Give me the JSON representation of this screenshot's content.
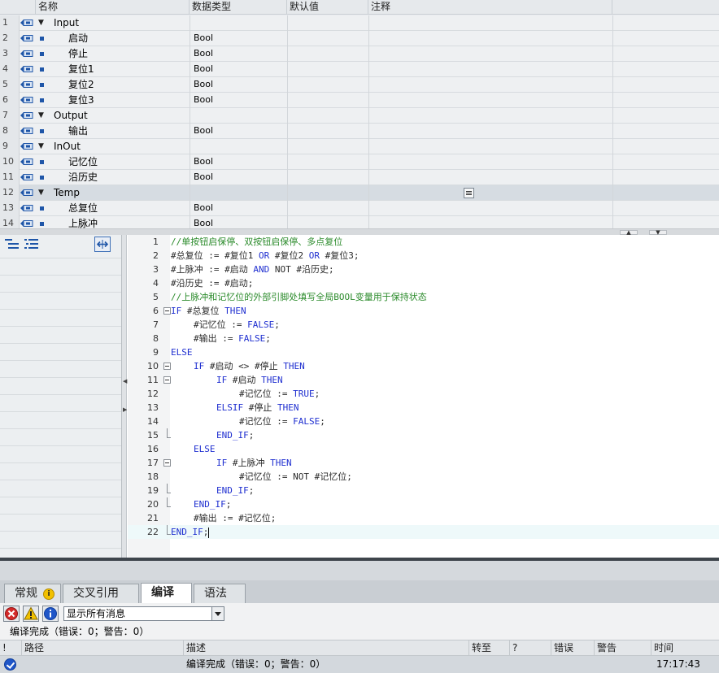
{
  "interface": {
    "columns": [
      "名称",
      "数据类型",
      "默认值",
      "注释"
    ],
    "rows": [
      {
        "num": "1",
        "name": "Input",
        "type": "",
        "section": true,
        "expanded": true
      },
      {
        "num": "2",
        "name": "启动",
        "type": "Bool",
        "section": false
      },
      {
        "num": "3",
        "name": "停止",
        "type": "Bool",
        "section": false
      },
      {
        "num": "4",
        "name": "复位1",
        "type": "Bool",
        "section": false
      },
      {
        "num": "5",
        "name": "复位2",
        "type": "Bool",
        "section": false
      },
      {
        "num": "6",
        "name": "复位3",
        "type": "Bool",
        "section": false
      },
      {
        "num": "7",
        "name": "Output",
        "type": "",
        "section": true,
        "expanded": true
      },
      {
        "num": "8",
        "name": "输出",
        "type": "Bool",
        "section": false
      },
      {
        "num": "9",
        "name": "InOut",
        "type": "",
        "section": true,
        "expanded": true
      },
      {
        "num": "10",
        "name": "记忆位",
        "type": "Bool",
        "section": false
      },
      {
        "num": "11",
        "name": "沿历史",
        "type": "Bool",
        "section": false
      },
      {
        "num": "12",
        "name": "Temp",
        "type": "",
        "section": true,
        "expanded": true,
        "selected": true
      },
      {
        "num": "13",
        "name": "总复位",
        "type": "Bool",
        "section": false
      },
      {
        "num": "14",
        "name": "上脉冲",
        "type": "Bool",
        "section": false
      }
    ]
  },
  "editor": {
    "lines": [
      {
        "num": "1",
        "indent": 0,
        "fold": "",
        "tokens": [
          {
            "t": "//单按钮启保停、双按钮启保停、多点复位",
            "c": "cm"
          }
        ]
      },
      {
        "num": "2",
        "indent": 0,
        "fold": "",
        "tokens": [
          {
            "t": "#总复位 := #复位1 ",
            "c": "vr"
          },
          {
            "t": "OR",
            "c": "kw"
          },
          {
            "t": " #复位2 ",
            "c": "vr"
          },
          {
            "t": "OR",
            "c": "kw"
          },
          {
            "t": " #复位3;",
            "c": "vr"
          }
        ]
      },
      {
        "num": "3",
        "indent": 0,
        "fold": "",
        "tokens": [
          {
            "t": "#上脉冲 := #启动 ",
            "c": "vr"
          },
          {
            "t": "AND",
            "c": "kw"
          },
          {
            "t": " NOT #沿历史;",
            "c": "vr"
          }
        ]
      },
      {
        "num": "4",
        "indent": 0,
        "fold": "",
        "tokens": [
          {
            "t": "#沿历史 := #启动;",
            "c": "vr"
          }
        ]
      },
      {
        "num": "5",
        "indent": 0,
        "fold": "",
        "tokens": [
          {
            "t": "//上脉冲和记忆位的外部引脚处填写全局BOOL变量用于保持状态",
            "c": "cm"
          }
        ]
      },
      {
        "num": "6",
        "indent": 0,
        "fold": "open",
        "tokens": [
          {
            "t": "IF",
            "c": "kw"
          },
          {
            "t": " #总复位 ",
            "c": "vr"
          },
          {
            "t": "THEN",
            "c": "kw"
          }
        ]
      },
      {
        "num": "7",
        "indent": 1,
        "fold": "",
        "tokens": [
          {
            "t": "#记忆位 := ",
            "c": "vr"
          },
          {
            "t": "FALSE",
            "c": "kw"
          },
          {
            "t": ";",
            "c": "vr"
          }
        ]
      },
      {
        "num": "8",
        "indent": 1,
        "fold": "",
        "tokens": [
          {
            "t": "#输出 := ",
            "c": "vr"
          },
          {
            "t": "FALSE",
            "c": "kw"
          },
          {
            "t": ";",
            "c": "vr"
          }
        ]
      },
      {
        "num": "9",
        "indent": 0,
        "fold": "",
        "tokens": [
          {
            "t": "ELSE",
            "c": "kw"
          }
        ]
      },
      {
        "num": "10",
        "indent": 1,
        "fold": "open",
        "tokens": [
          {
            "t": "IF",
            "c": "kw"
          },
          {
            "t": " #启动 <> #停止 ",
            "c": "vr"
          },
          {
            "t": "THEN",
            "c": "kw"
          }
        ]
      },
      {
        "num": "11",
        "indent": 2,
        "fold": "open",
        "tokens": [
          {
            "t": "IF",
            "c": "kw"
          },
          {
            "t": " #启动 ",
            "c": "vr"
          },
          {
            "t": "THEN",
            "c": "kw"
          }
        ]
      },
      {
        "num": "12",
        "indent": 3,
        "fold": "",
        "tokens": [
          {
            "t": "#记忆位 := ",
            "c": "vr"
          },
          {
            "t": "TRUE",
            "c": "kw"
          },
          {
            "t": ";",
            "c": "vr"
          }
        ]
      },
      {
        "num": "13",
        "indent": 2,
        "fold": "",
        "tokens": [
          {
            "t": "ELSIF",
            "c": "kw"
          },
          {
            "t": " #停止 ",
            "c": "vr"
          },
          {
            "t": "THEN",
            "c": "kw"
          }
        ]
      },
      {
        "num": "14",
        "indent": 3,
        "fold": "",
        "tokens": [
          {
            "t": "#记忆位 := ",
            "c": "vr"
          },
          {
            "t": "FALSE",
            "c": "kw"
          },
          {
            "t": ";",
            "c": "vr"
          }
        ]
      },
      {
        "num": "15",
        "indent": 2,
        "fold": "end",
        "tokens": [
          {
            "t": "END_IF",
            "c": "kw"
          },
          {
            "t": ";",
            "c": "vr"
          }
        ]
      },
      {
        "num": "16",
        "indent": 1,
        "fold": "",
        "tokens": [
          {
            "t": "ELSE",
            "c": "kw"
          }
        ]
      },
      {
        "num": "17",
        "indent": 2,
        "fold": "open",
        "tokens": [
          {
            "t": "IF",
            "c": "kw"
          },
          {
            "t": " #上脉冲 ",
            "c": "vr"
          },
          {
            "t": "THEN",
            "c": "kw"
          }
        ]
      },
      {
        "num": "18",
        "indent": 3,
        "fold": "",
        "tokens": [
          {
            "t": "#记忆位 := NOT #记忆位;",
            "c": "vr"
          }
        ]
      },
      {
        "num": "19",
        "indent": 2,
        "fold": "end",
        "tokens": [
          {
            "t": "END_IF",
            "c": "kw"
          },
          {
            "t": ";",
            "c": "vr"
          }
        ]
      },
      {
        "num": "20",
        "indent": 1,
        "fold": "end",
        "tokens": [
          {
            "t": "END_IF",
            "c": "kw"
          },
          {
            "t": ";",
            "c": "vr"
          }
        ]
      },
      {
        "num": "21",
        "indent": 1,
        "fold": "",
        "tokens": [
          {
            "t": "#输出 := #记忆位;",
            "c": "vr"
          }
        ]
      },
      {
        "num": "22",
        "indent": 0,
        "fold": "end",
        "active": true,
        "tokens": [
          {
            "t": "END_IF",
            "c": "kw"
          },
          {
            "t": ";",
            "c": "vr"
          }
        ]
      }
    ]
  },
  "inspector": {
    "tabs": [
      "常规",
      "交叉引用",
      "编译",
      "语法"
    ],
    "active_tab": "编译",
    "filter": "显示所有消息",
    "status": "编译完成（错误：0；警告：0）",
    "columns": [
      "!",
      "路径",
      "描述",
      "转至",
      "?",
      "错误",
      "警告",
      "时间"
    ],
    "message": {
      "description": "编译完成（错误：0；警告：0）",
      "time": "17:17:43"
    }
  },
  "colors": {
    "keyword": "#1f2fd0",
    "comment": "#2b8b2b",
    "selected_row": "#d6dce2",
    "accent": "#1f56a8"
  }
}
